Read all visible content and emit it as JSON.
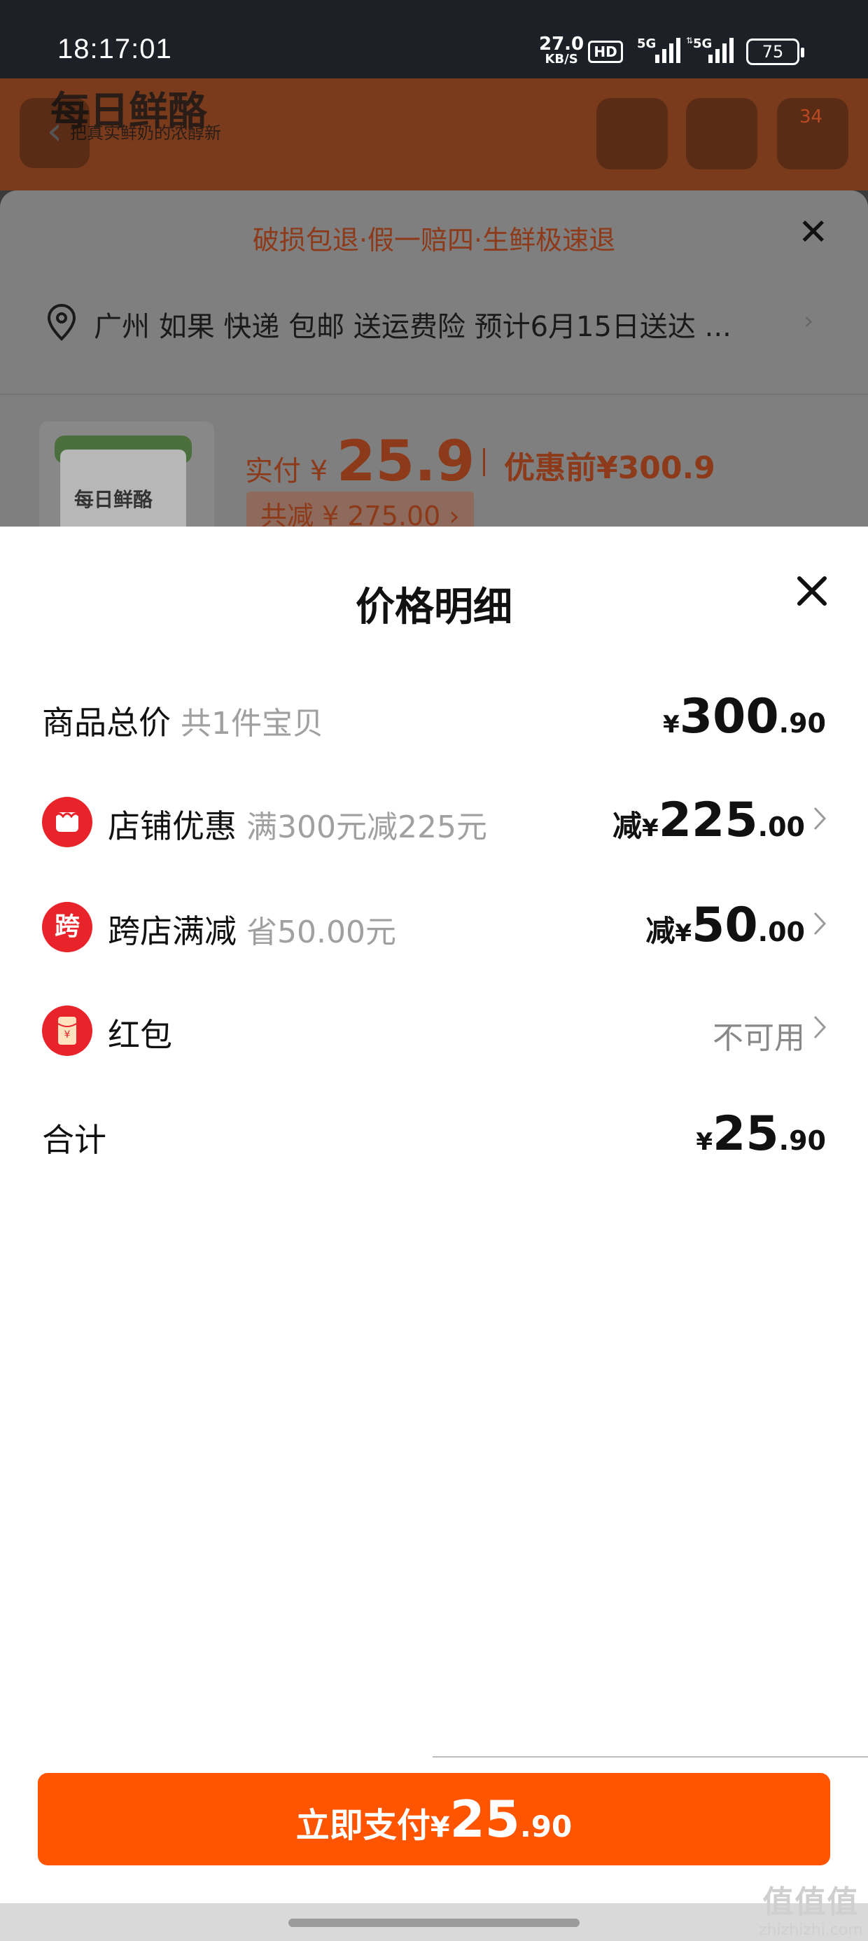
{
  "status_bar": {
    "time": "18:17:01",
    "net_speed_value": "27.0",
    "net_speed_unit": "KB/S",
    "hd_label": "HD",
    "sim1": "5G",
    "sim2": "5G",
    "battery": "75"
  },
  "background": {
    "logo": "每日鲜酪",
    "slogan": "把真实鲜奶的浓醇新",
    "cart_badge": "34",
    "promo_banner": "破损包退·假一赔四·生鲜极速退",
    "address": "广州 如果  快递 包邮 送运费险 预计6月15日送达 ...",
    "product_brand": "每日鲜酪",
    "paid_label": "实付",
    "paid_currency": "¥",
    "paid_amount": "25.9",
    "before_discount": "优惠前¥300.9",
    "total_saved": "共减 ¥ 275.00 ›"
  },
  "price_detail": {
    "title": "价格明细",
    "rows": [
      {
        "label": "商品总价",
        "sub": "共1件宝贝",
        "currency": "¥",
        "int": "300",
        "dec": ".90"
      },
      {
        "label": "店铺优惠",
        "sub": "满300元减225元",
        "reduce": "减",
        "currency": "¥",
        "int": "225",
        "dec": ".00"
      },
      {
        "label": "跨店满减",
        "sub": "省50.00元",
        "icon_text": "跨",
        "reduce": "减",
        "currency": "¥",
        "int": "50",
        "dec": ".00"
      },
      {
        "label": "红包",
        "value": "不可用"
      },
      {
        "label": "合计",
        "currency": "¥",
        "int": "25",
        "dec": ".90"
      }
    ]
  },
  "pay_button": {
    "label": "立即支付",
    "currency": "¥",
    "int": "25",
    "dec": ".90"
  },
  "watermark": {
    "logo": "值值值",
    "domain": "zhizhizhi.com"
  },
  "colors": {
    "accent": "#ff5500",
    "discount": "#f0600f",
    "icon_red": "#e8232a"
  }
}
